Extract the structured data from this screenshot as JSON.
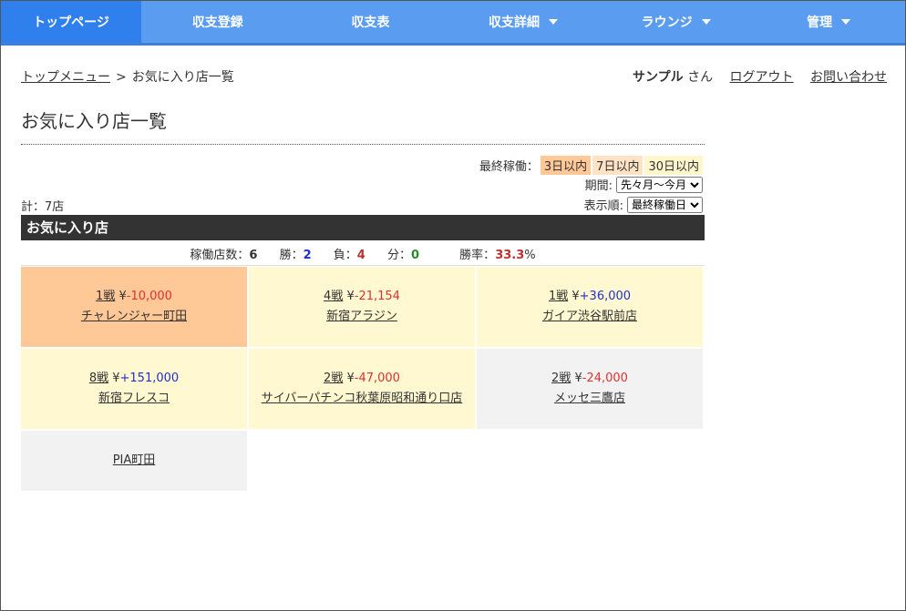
{
  "nav": {
    "items": [
      {
        "label": "トップページ",
        "active": true
      },
      {
        "label": "収支登録"
      },
      {
        "label": "収支表"
      },
      {
        "label": "収支詳細",
        "dropdown": true
      },
      {
        "label": "ラウンジ",
        "dropdown": true
      },
      {
        "label": "管理",
        "dropdown": true
      }
    ]
  },
  "breadcrumb": {
    "home": "トップメニュー",
    "sep": ">",
    "current": "お気に入り店一覧"
  },
  "user": {
    "name": "サンプル",
    "suffix": "さん",
    "logout": "ログアウト",
    "contact": "お問い合わせ"
  },
  "page_title": "お気に入り店一覧",
  "filters": {
    "last_active_label": "最終稼働：",
    "last_active_options": [
      "3日以内",
      "7日以内",
      "30日以内"
    ],
    "period_label": "期間:",
    "period_value": "先々月～今月",
    "sort_label": "表示順:",
    "sort_value": "最終稼働日"
  },
  "total": "計：7店",
  "section_title": "お気に入り店",
  "stats": {
    "stores_label": "稼働店数：",
    "stores": "6",
    "win_label": "勝：",
    "win": "2",
    "lose_label": "負：",
    "lose": "4",
    "draw_label": "分：",
    "draw": "0",
    "rate_label": "勝率：",
    "rate": "33.3",
    "rate_unit": "%"
  },
  "stores": [
    {
      "games": "1戦",
      "yen": "¥",
      "amount": "-10,000",
      "name": "チャレンジャー町田"
    },
    {
      "games": "4戦",
      "yen": "¥",
      "amount": "-21,154",
      "name": "新宿アラジン"
    },
    {
      "games": "1戦",
      "yen": "¥",
      "amount": "+36,000",
      "name": "ガイア渋谷駅前店"
    },
    {
      "games": "8戦",
      "yen": "¥",
      "amount": "+151,000",
      "name": "新宿フレスコ"
    },
    {
      "games": "2戦",
      "yen": "¥",
      "amount": "-47,000",
      "name": "サイバーパチンコ秋葉原昭和通り口店"
    },
    {
      "games": "2戦",
      "yen": "¥",
      "amount": "-24,000",
      "name": "メッセ三鷹店"
    },
    {
      "games": "",
      "yen": "",
      "amount": "",
      "name": "PIA町田"
    }
  ],
  "colors": {
    "orange": "#ffc896",
    "yellow": "#fff8d0",
    "gray": "#f2f2f2"
  }
}
